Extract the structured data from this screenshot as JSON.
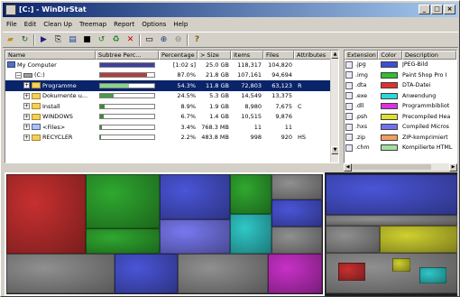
{
  "window": {
    "title": "[C:] - WinDirStat",
    "min": "_",
    "max": "□",
    "close": "×"
  },
  "menu": [
    "File",
    "Edit",
    "Clean Up",
    "Treemap",
    "Report",
    "Options",
    "Help"
  ],
  "toolbar": {
    "icons": [
      "open-icon",
      "refresh-icon",
      "play-icon",
      "copy-icon",
      "explorer-icon",
      "cmd-icon",
      "refresh-select-icon",
      "recycle-icon",
      "delete-icon",
      "properties-icon",
      "zoom-in-icon",
      "zoom-out-icon",
      "help-icon"
    ]
  },
  "tree": {
    "columns": [
      "Name",
      "Subtree Perc...",
      "Percentage",
      "> Size",
      "Items",
      "Files",
      "Attributes"
    ],
    "rows": [
      {
        "name": "My Computer",
        "perc": "[1:02 s]",
        "size": "25.0 GB",
        "items": "118,317",
        "files": "104,820",
        "attr": "",
        "bar": 1.0,
        "barcolor": "#4040a0",
        "indent": 0,
        "icon": "computer"
      },
      {
        "name": "(C:)",
        "perc": "87.0%",
        "size": "21.8 GB",
        "items": "107,161",
        "files": "94,694",
        "attr": "",
        "bar": 0.87,
        "barcolor": "#b04040",
        "indent": 1,
        "icon": "drive",
        "exp": "−"
      },
      {
        "name": "Programme",
        "perc": "54.3%",
        "size": "11.8 GB",
        "items": "72,803",
        "files": "63,123",
        "attr": "R",
        "bar": 0.54,
        "barcolor": "#8ad48a",
        "indent": 2,
        "icon": "folder",
        "exp": "+",
        "sel": true
      },
      {
        "name": "Dokumente u...",
        "perc": "24.5%",
        "size": "5.3 GB",
        "items": "14,549",
        "files": "13,375",
        "attr": "",
        "bar": 0.245,
        "barcolor": "#4a9a4a",
        "indent": 2,
        "icon": "folder",
        "exp": "+"
      },
      {
        "name": "Install",
        "perc": "8.9%",
        "size": "1.9 GB",
        "items": "8,980",
        "files": "7,675",
        "attr": "C",
        "bar": 0.089,
        "barcolor": "#3a8a3a",
        "indent": 2,
        "icon": "folder",
        "exp": "+"
      },
      {
        "name": "WINDOWS",
        "perc": "6.7%",
        "size": "1.4 GB",
        "items": "10,515",
        "files": "9,876",
        "attr": "",
        "bar": 0.067,
        "barcolor": "#3a8a3a",
        "indent": 2,
        "icon": "folder",
        "exp": "+"
      },
      {
        "name": "<Files>",
        "perc": "3.4%",
        "size": "768.3 MB",
        "items": "11",
        "files": "11",
        "attr": "",
        "bar": 0.034,
        "barcolor": "#3a8a3a",
        "indent": 2,
        "icon": "files",
        "exp": "+"
      },
      {
        "name": "RECYCLER",
        "perc": "2.2%",
        "size": "483.8 MB",
        "items": "998",
        "files": "920",
        "attr": "HS",
        "bar": 0.022,
        "barcolor": "#3a8a3a",
        "indent": 2,
        "icon": "folder",
        "exp": "+"
      }
    ]
  },
  "extensions": {
    "columns": [
      "Extension",
      "Color",
      "Description"
    ],
    "rows": [
      {
        "ext": ".jpg",
        "color": "#3b4fd8",
        "desc": "JPEG-Bild"
      },
      {
        "ext": ".img",
        "color": "#2fbf2f",
        "desc": "Paint Shop Pro I"
      },
      {
        "ext": ".dta",
        "color": "#e03030",
        "desc": "DTA-Datei"
      },
      {
        "ext": ".exe",
        "color": "#2fd8d8",
        "desc": "Anwendung"
      },
      {
        "ext": ".dll",
        "color": "#e030e0",
        "desc": "Programmbibliot"
      },
      {
        "ext": ".psh",
        "color": "#e0e030",
        "desc": "Precompiled Hea"
      },
      {
        "ext": ".hxs",
        "color": "#7070f0",
        "desc": "Compiled Micros"
      },
      {
        "ext": ".zip",
        "color": "#f0a060",
        "desc": "ZIP-komprimiert"
      },
      {
        "ext": ".chm",
        "color": "#a0e0a0",
        "desc": "Kompilierte HTML"
      }
    ]
  }
}
